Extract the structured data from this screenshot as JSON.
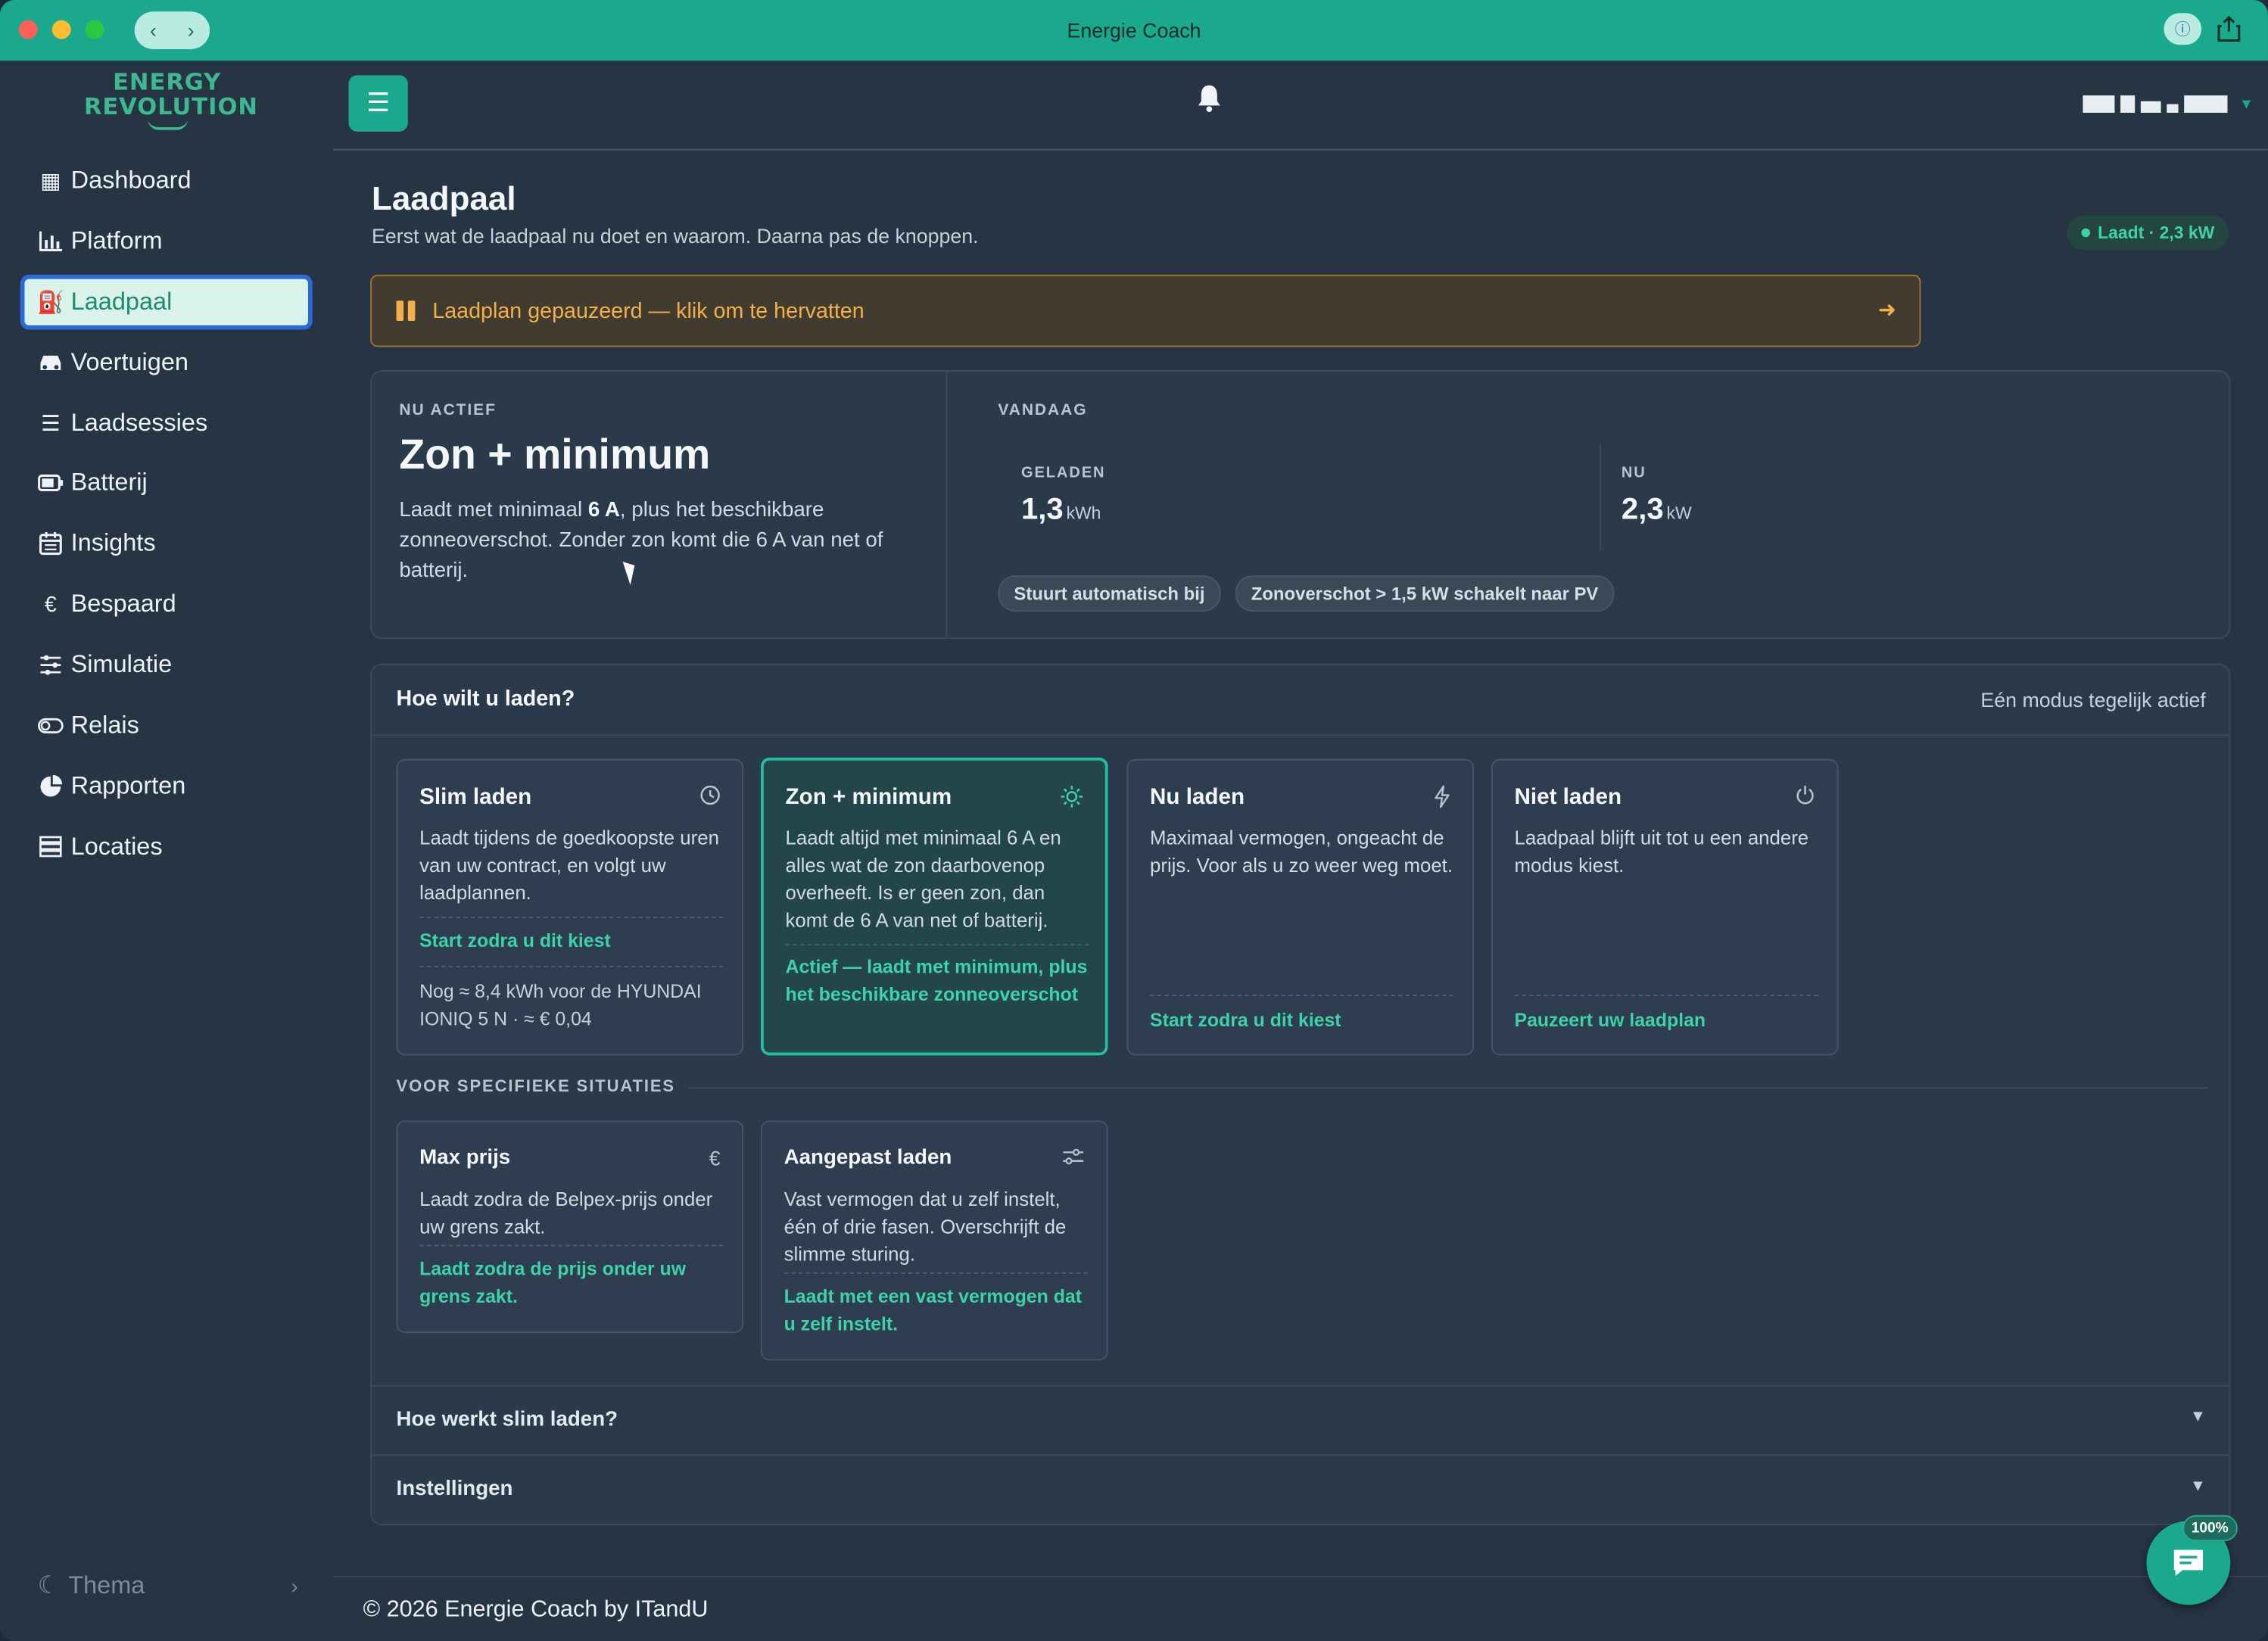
{
  "window": {
    "title": "Energie Coach",
    "nav_back": "‹",
    "nav_forward": "›"
  },
  "brand": {
    "line1": "ENERGY",
    "line2": "REVOLUTION"
  },
  "sidebar": {
    "items": [
      {
        "label": "Dashboard",
        "icon": "grid-icon"
      },
      {
        "label": "Platform",
        "icon": "bar-chart-icon"
      },
      {
        "label": "Laadpaal",
        "icon": "charger-icon",
        "active": true
      },
      {
        "label": "Voertuigen",
        "icon": "car-icon"
      },
      {
        "label": "Laadsessies",
        "icon": "list-icon"
      },
      {
        "label": "Batterij",
        "icon": "battery-icon"
      },
      {
        "label": "Insights",
        "icon": "calendar-icon"
      },
      {
        "label": "Bespaard",
        "icon": "euro-icon"
      },
      {
        "label": "Simulatie",
        "icon": "sliders-icon"
      },
      {
        "label": "Relais",
        "icon": "toggle-icon"
      },
      {
        "label": "Rapporten",
        "icon": "pie-chart-icon"
      },
      {
        "label": "Locaties",
        "icon": "server-icon"
      }
    ],
    "theme_label": "Thema"
  },
  "page": {
    "title": "Laadpaal",
    "subtitle": "Eerst wat de laadpaal nu doet en waarom. Daarna pas de knoppen.",
    "status_badge": "Laadt · 2,3 kW"
  },
  "banner": {
    "text": "Laadplan gepauzeerd — klik om te hervatten"
  },
  "active": {
    "label": "NU ACTIEF",
    "title": "Zon + minimum",
    "desc_pre": "Laadt met minimaal ",
    "desc_bold": "6 A",
    "desc_post": ", plus het beschikbare zonneoverschot. Zonder zon komt die 6 A van net of batterij."
  },
  "today": {
    "label": "VANDAAG",
    "charged_label": "GELADEN",
    "charged_value": "1,3",
    "charged_unit": "kWh",
    "now_label": "NU",
    "now_value": "2,3",
    "now_unit": "kW",
    "chips": [
      "Stuurt automatisch bij",
      "Zonoverschot > 1,5 kW schakelt naar PV"
    ]
  },
  "modes": {
    "heading": "Hoe wilt u laden?",
    "note": "Eén modus tegelijk actief",
    "primary": [
      {
        "title": "Slim laden",
        "icon": "clock-icon",
        "desc": "Laadt tijdens de goedkoopste uren van uw contract, en volgt uw laadplannen.",
        "action": "Start zodra u dit kiest",
        "note": "Nog ≈ 8,4 kWh voor de HYUNDAI IONIQ 5 N · ≈ € 0,04"
      },
      {
        "title": "Zon + minimum",
        "icon": "sun-icon",
        "desc": "Laadt altijd met minimaal 6 A en alles wat de zon daarbovenop overheeft. Is er geen zon, dan komt de 6 A van net of batterij.",
        "action": "Actief — laadt met minimum, plus het beschikbare zonneoverschot",
        "active": true
      },
      {
        "title": "Nu laden",
        "icon": "lightning-icon",
        "desc": "Maximaal vermogen, ongeacht de prijs. Voor als u zo weer weg moet.",
        "action": "Start zodra u dit kiest"
      },
      {
        "title": "Niet laden",
        "icon": "power-icon",
        "desc": "Laadpaal blijft uit tot u een andere modus kiest.",
        "action": "Pauzeert uw laadplan"
      }
    ],
    "specific_label": "VOOR SPECIFIEKE SITUATIES",
    "specific": [
      {
        "title": "Max prijs",
        "icon": "euro-icon",
        "desc": "Laadt zodra de Belpex-prijs onder uw grens zakt.",
        "action": "Laadt zodra de prijs onder uw grens zakt."
      },
      {
        "title": "Aangepast laden",
        "icon": "sliders-icon",
        "desc": "Vast vermogen dat u zelf instelt, één of drie fasen. Overschrijft de slimme sturing.",
        "action": "Laadt met een vast vermogen dat u zelf instelt."
      }
    ]
  },
  "accordions": [
    {
      "title": "Hoe werkt slim laden?"
    },
    {
      "title": "Instellingen"
    }
  ],
  "footer": {
    "text": "© 2026 Energie Coach by ITandU"
  },
  "chat": {
    "badge": "100%"
  },
  "colors": {
    "accent": "#1ba98e",
    "sidebar": "#263444",
    "warning": "#f2b04a"
  }
}
